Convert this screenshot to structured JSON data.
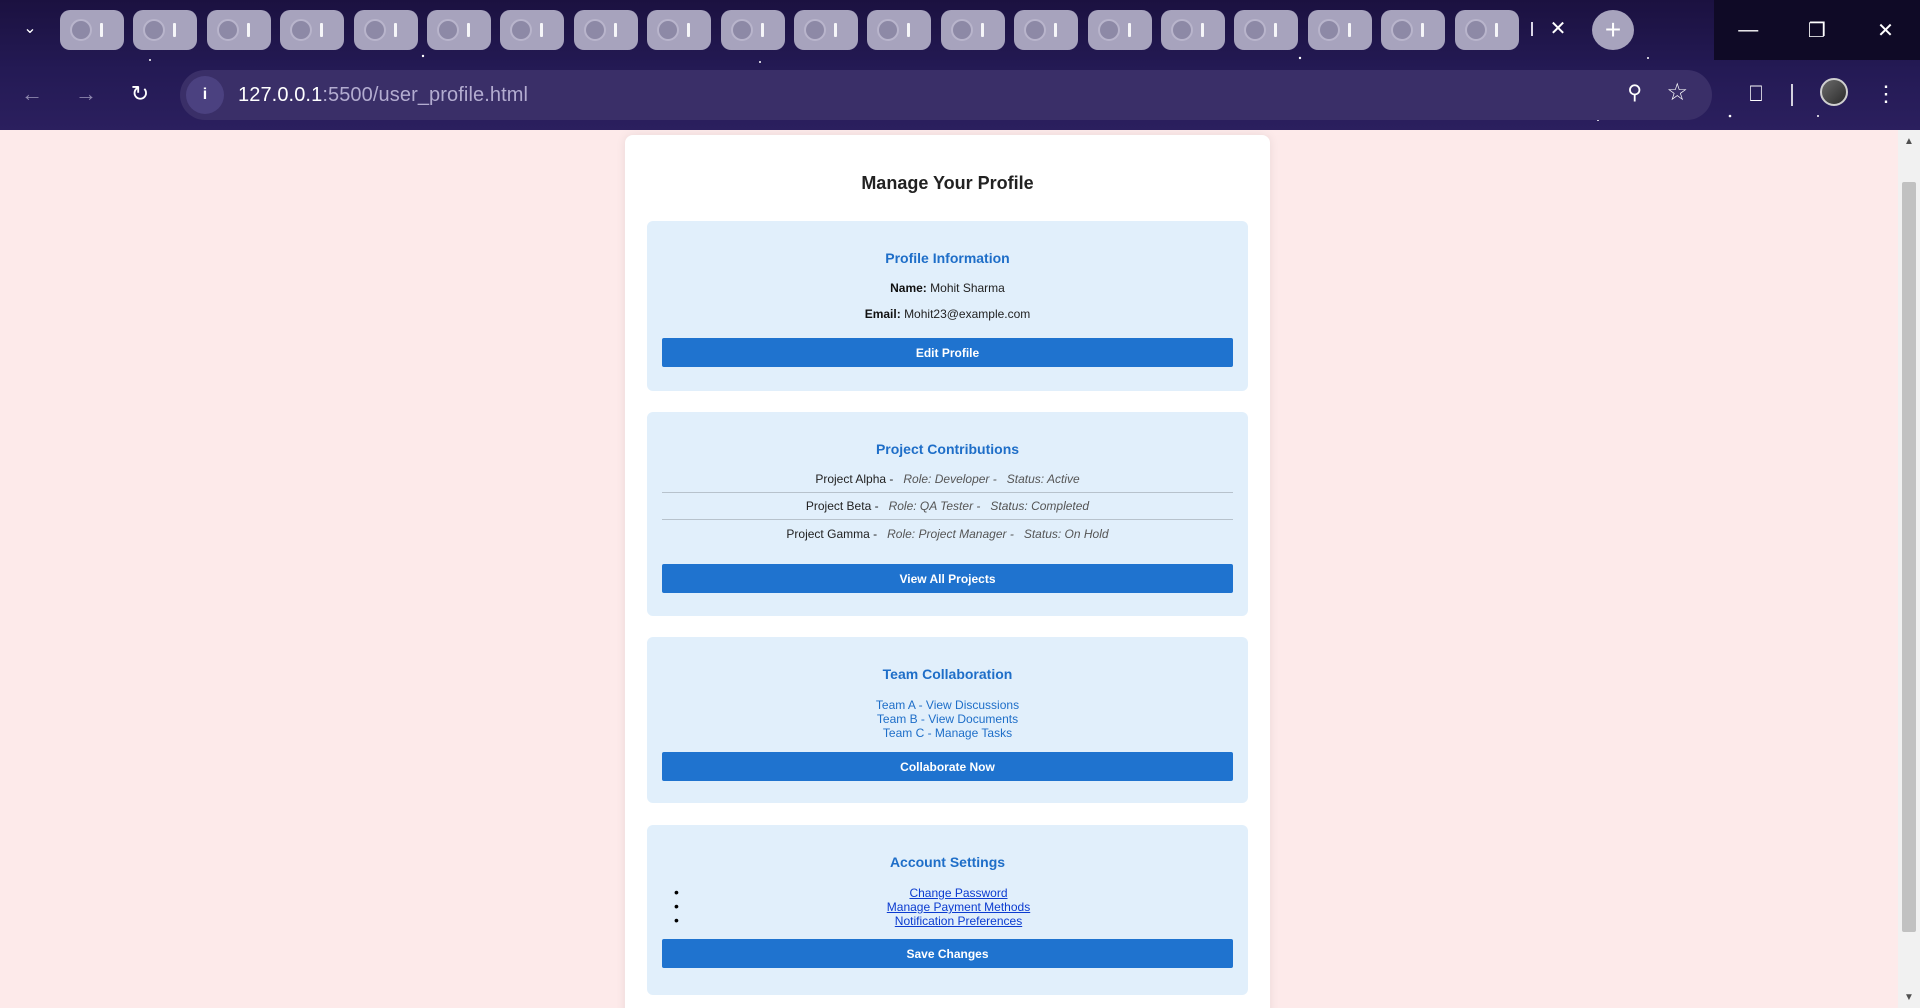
{
  "browser": {
    "url_host": "127.0.0.1",
    "url_rest": ":5500/user_profile.html",
    "tab_count": 20
  },
  "page": {
    "title": "Manage Your Profile",
    "profile": {
      "heading": "Profile Information",
      "name_label": "Name:",
      "name_value": "Mohit Sharma",
      "email_label": "Email:",
      "email_value": "Mohit23@example.com",
      "button": "Edit Profile"
    },
    "projects": {
      "heading": "Project Contributions",
      "items": [
        {
          "name": "Project Alpha -",
          "role": "Role: Developer -",
          "status": "Status: Active"
        },
        {
          "name": "Project Beta -",
          "role": "Role: QA Tester -",
          "status": "Status: Completed"
        },
        {
          "name": "Project Gamma -",
          "role": "Role: Project Manager -",
          "status": "Status: On Hold"
        }
      ],
      "button": "View All Projects"
    },
    "team": {
      "heading": "Team Collaboration",
      "links": [
        "Team A - View Discussions",
        "Team B - View Documents",
        "Team C - Manage Tasks"
      ],
      "button": "Collaborate Now"
    },
    "settings": {
      "heading": "Account Settings",
      "links": [
        "Change Password",
        "Manage Payment Methods",
        "Notification Preferences"
      ],
      "button": "Save Changes"
    }
  },
  "colors": {
    "page_bg": "#fdeaea",
    "section_bg": "#e1effb",
    "accent": "#1f73cf",
    "heading_blue": "#1e6ec8",
    "link_blue": "#0b3bd0"
  }
}
